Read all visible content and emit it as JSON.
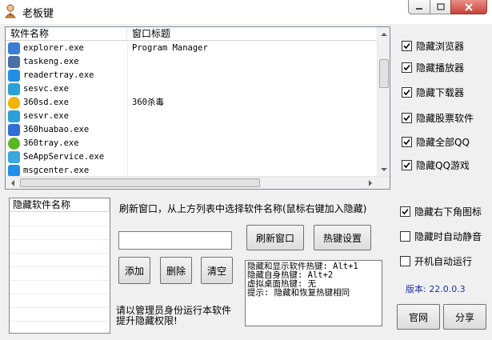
{
  "window": {
    "title": "老板键"
  },
  "process_list": {
    "columns": [
      "软件名称",
      "窗口标题"
    ],
    "rows": [
      {
        "name": "explorer.exe",
        "title": "Program Manager",
        "icon": "explorer-icon",
        "color": "#3a7bd5"
      },
      {
        "name": "taskeng.exe",
        "title": "",
        "icon": "task-engine-icon",
        "color": "#4a6fa5"
      },
      {
        "name": "readertray.exe",
        "title": "",
        "icon": "reader-icon",
        "color": "#1f8ee6"
      },
      {
        "name": "sesvc.exe",
        "title": "",
        "icon": "sogou-explorer-icon",
        "color": "#2aa0d8"
      },
      {
        "name": "360sd.exe",
        "title": "360杀毒",
        "icon": "360-shield-icon",
        "color": "#f2b400"
      },
      {
        "name": "sesvr.exe",
        "title": "",
        "icon": "sogou-explorer-icon",
        "color": "#2aa0d8"
      },
      {
        "name": "360huabao.exe",
        "title": "",
        "icon": "360-huabao-icon",
        "color": "#2f6fd6"
      },
      {
        "name": "360tray.exe",
        "title": "",
        "icon": "360-tray-icon",
        "color": "#56b824"
      },
      {
        "name": "SeAppService.exe",
        "title": "",
        "icon": "app-service-icon",
        "color": "#39a7e0"
      },
      {
        "name": "msgcenter.exe",
        "title": "",
        "icon": "message-center-icon",
        "color": "#1e90e8"
      }
    ]
  },
  "hide_options": [
    {
      "label": "隐藏浏览器",
      "checked": true
    },
    {
      "label": "隐藏播放器",
      "checked": true
    },
    {
      "label": "隐藏下载器",
      "checked": true
    },
    {
      "label": "隐藏股票软件",
      "checked": true
    },
    {
      "label": "隐藏全部QQ",
      "checked": true
    },
    {
      "label": "隐藏QQ游戏",
      "checked": true
    }
  ],
  "extra_options": [
    {
      "label": "隐藏右下角图标",
      "checked": true
    },
    {
      "label": "隐藏时自动静音",
      "checked": false
    },
    {
      "label": "开机自动运行",
      "checked": false
    }
  ],
  "hidden_list": {
    "header": "隐藏软件名称",
    "items": []
  },
  "hint": "刷新窗口，从上方列表中选择软件名称(鼠标右键加入隐藏)",
  "input": {
    "value": ""
  },
  "buttons": {
    "add": "添加",
    "delete": "删除",
    "clear": "清空",
    "refresh": "刷新窗口",
    "hotkey": "热键设置",
    "website": "官网",
    "share": "分享"
  },
  "hotkey_info": {
    "lines": [
      "隐藏和显示软件热键: Alt+1",
      "隐藏自身热键: Alt+2",
      "虚拟桌面热键: 无",
      "提示: 隐藏和恢复热键相同"
    ]
  },
  "admin_notice": [
    "请以管理员身份运行本软件",
    "提升隐藏权限!"
  ],
  "version": "版本: 22.0.0.3"
}
